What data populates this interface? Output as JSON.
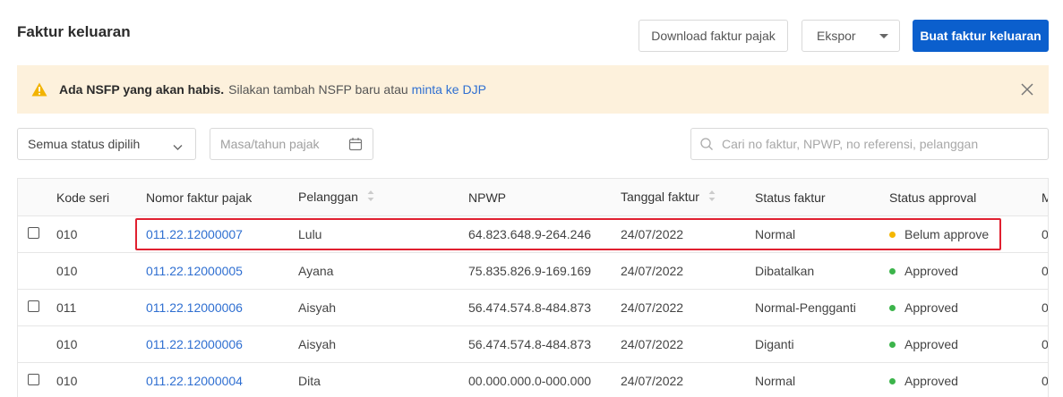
{
  "header": {
    "title": "Faktur keluaran",
    "download_label": "Download faktur pajak",
    "ekspor_label": "Ekspor",
    "create_label": "Buat faktur keluaran"
  },
  "alert": {
    "bold_text": "Ada NSFP yang akan habis.",
    "message": "Silakan tambah NSFP baru atau",
    "link": "minta ke DJP",
    "icon": "warning-icon"
  },
  "filters": {
    "status_value": "Semua status dipilih",
    "date_placeholder": "Masa/tahun pajak",
    "search_placeholder": "Cari no faktur, NPWP, no referensi, pelanggan"
  },
  "table": {
    "columns": [
      "Kode seri",
      "Nomor faktur pajak",
      "Pelanggan",
      "NPWP",
      "Tanggal faktur",
      "Status faktur",
      "Status approval",
      "M"
    ],
    "rows": [
      {
        "checkbox": true,
        "kode": "010",
        "nomor": "011.22.12000007",
        "pelanggan": "Lulu",
        "npwp": "64.823.648.9-264.246",
        "tanggal": "24/07/2022",
        "status": "Normal",
        "approval": "Belum approve",
        "approval_color": "#f5b700",
        "m": "0"
      },
      {
        "checkbox": false,
        "kode": "010",
        "nomor": "011.22.12000005",
        "pelanggan": "Ayana",
        "npwp": "75.835.826.9-169.169",
        "tanggal": "24/07/2022",
        "status": "Dibatalkan",
        "approval": "Approved",
        "approval_color": "#3cb44b",
        "m": "0"
      },
      {
        "checkbox": true,
        "kode": "011",
        "nomor": "011.22.12000006",
        "pelanggan": "Aisyah",
        "npwp": "56.474.574.8-484.873",
        "tanggal": "24/07/2022",
        "status": "Normal-Pengganti",
        "approval": "Approved",
        "approval_color": "#3cb44b",
        "m": "0"
      },
      {
        "checkbox": false,
        "kode": "010",
        "nomor": "011.22.12000006",
        "pelanggan": "Aisyah",
        "npwp": "56.474.574.8-484.873",
        "tanggal": "24/07/2022",
        "status": "Diganti",
        "approval": "Approved",
        "approval_color": "#3cb44b",
        "m": "0"
      },
      {
        "checkbox": true,
        "kode": "010",
        "nomor": "011.22.12000004",
        "pelanggan": "Dita",
        "npwp": "00.000.000.0-000.000",
        "tanggal": "24/07/2022",
        "status": "Normal",
        "approval": "Approved",
        "approval_color": "#3cb44b",
        "m": "0"
      }
    ]
  }
}
